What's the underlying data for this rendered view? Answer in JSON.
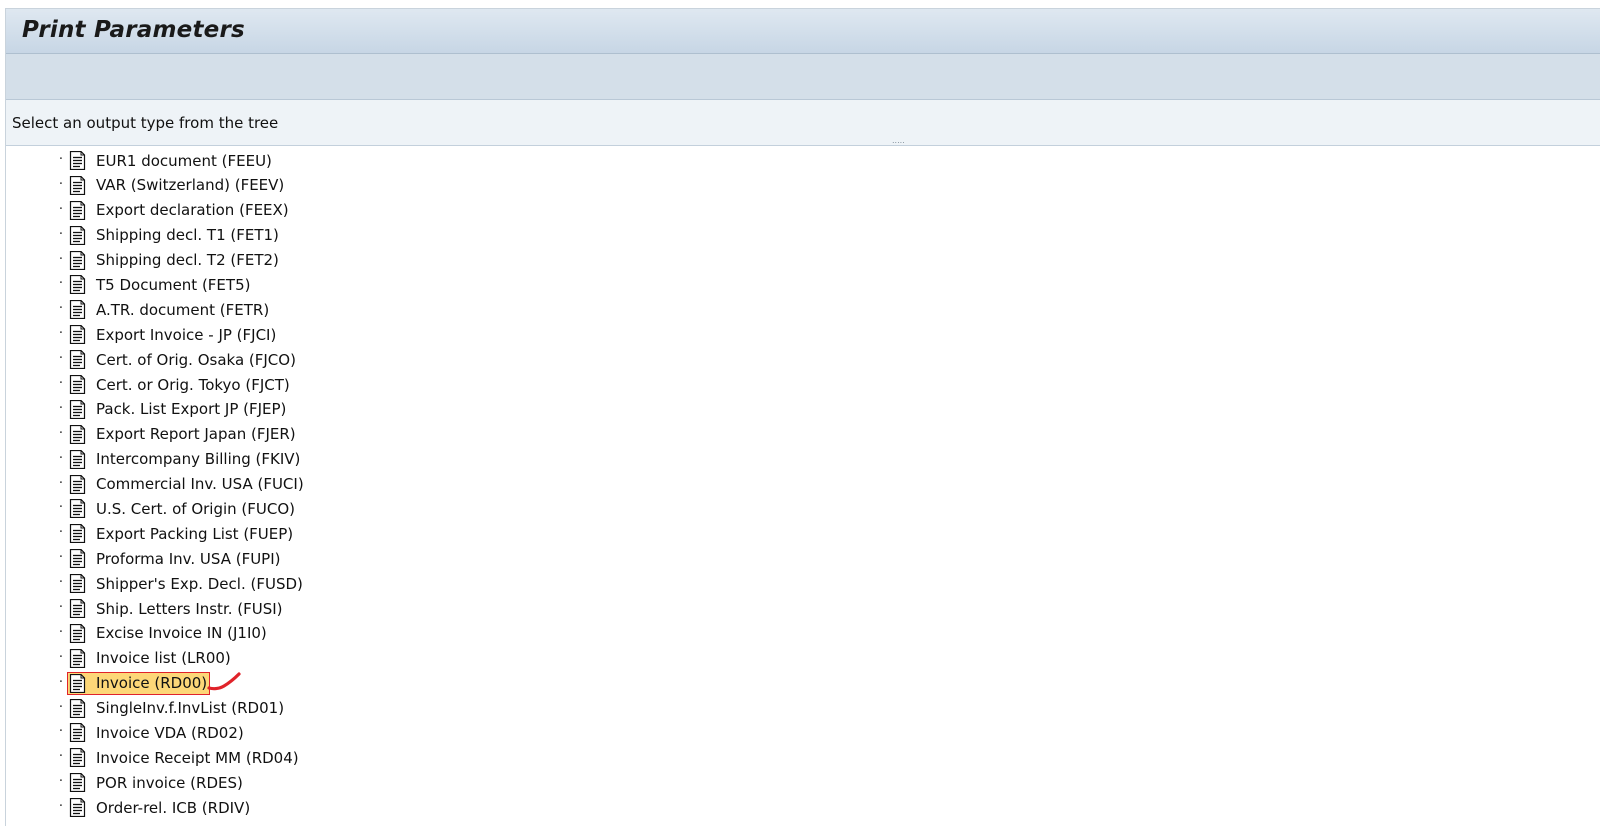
{
  "window": {
    "title": "Print Parameters"
  },
  "instruction": {
    "text": "Select an output type from the tree",
    "splitter_grip": "....."
  },
  "tree": {
    "items": [
      {
        "label": "EUR1 document (FEEU)",
        "icon": "document-icon",
        "selected": false
      },
      {
        "label": "VAR (Switzerland) (FEEV)",
        "icon": "document-icon",
        "selected": false
      },
      {
        "label": "Export declaration (FEEX)",
        "icon": "document-icon",
        "selected": false
      },
      {
        "label": "Shipping decl. T1 (FET1)",
        "icon": "document-icon",
        "selected": false
      },
      {
        "label": "Shipping decl. T2 (FET2)",
        "icon": "document-icon",
        "selected": false
      },
      {
        "label": "T5 Document (FET5)",
        "icon": "document-icon",
        "selected": false
      },
      {
        "label": "A.TR. document (FETR)",
        "icon": "document-icon",
        "selected": false
      },
      {
        "label": "Export Invoice - JP (FJCI)",
        "icon": "document-icon",
        "selected": false
      },
      {
        "label": "Cert. of Orig. Osaka (FJCO)",
        "icon": "document-icon",
        "selected": false
      },
      {
        "label": "Cert. or Orig. Tokyo (FJCT)",
        "icon": "document-icon",
        "selected": false
      },
      {
        "label": "Pack. List Export JP (FJEP)",
        "icon": "document-icon",
        "selected": false
      },
      {
        "label": "Export Report Japan (FJER)",
        "icon": "document-icon",
        "selected": false
      },
      {
        "label": "Intercompany Billing (FKIV)",
        "icon": "document-icon",
        "selected": false
      },
      {
        "label": "Commercial Inv. USA (FUCI)",
        "icon": "document-icon",
        "selected": false
      },
      {
        "label": "U.S. Cert. of Origin (FUCO)",
        "icon": "document-icon",
        "selected": false
      },
      {
        "label": "Export Packing List (FUEP)",
        "icon": "document-icon",
        "selected": false
      },
      {
        "label": "Proforma Inv. USA (FUPI)",
        "icon": "document-icon",
        "selected": false
      },
      {
        "label": "Shipper's Exp. Decl. (FUSD)",
        "icon": "document-icon",
        "selected": false
      },
      {
        "label": "Ship. Letters Instr. (FUSI)",
        "icon": "document-icon",
        "selected": false
      },
      {
        "label": "Excise Invoice IN (J1I0)",
        "icon": "document-icon",
        "selected": false
      },
      {
        "label": "Invoice list (LR00)",
        "icon": "document-icon",
        "selected": false
      },
      {
        "label": "Invoice (RD00)",
        "icon": "document-icon",
        "selected": true
      },
      {
        "label": "SingleInv.f.InvList (RD01)",
        "icon": "document-icon",
        "selected": false
      },
      {
        "label": "Invoice VDA (RD02)",
        "icon": "document-icon",
        "selected": false
      },
      {
        "label": "Invoice Receipt MM (RD04)",
        "icon": "document-icon",
        "selected": false
      },
      {
        "label": "POR invoice (RDES)",
        "icon": "document-icon",
        "selected": false
      },
      {
        "label": "Order-rel. ICB (RDIV)",
        "icon": "document-icon",
        "selected": false
      }
    ]
  },
  "colors": {
    "selection_fill": "#fdd778",
    "selection_border": "#e0232a",
    "annotation_stroke": "#e0232a"
  }
}
